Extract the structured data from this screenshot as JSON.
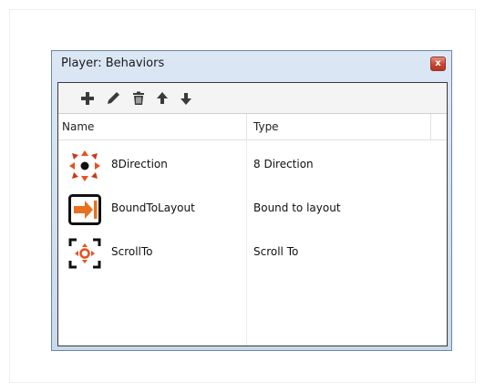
{
  "window": {
    "title": "Player: Behaviors",
    "close_label": "x"
  },
  "toolbar": {
    "buttons": [
      {
        "icon": "add-icon"
      },
      {
        "icon": "pencil-icon"
      },
      {
        "icon": "trash-icon"
      },
      {
        "icon": "arrow-up-icon"
      },
      {
        "icon": "arrow-down-icon"
      }
    ]
  },
  "table": {
    "columns": [
      "Name",
      "Type"
    ],
    "rows": [
      {
        "name": "8Direction",
        "type": "8 Direction",
        "icon": "eight-direction-icon"
      },
      {
        "name": "BoundToLayout",
        "type": "Bound to layout",
        "icon": "bound-to-layout-icon"
      },
      {
        "name": "ScrollTo",
        "type": "Scroll To",
        "icon": "scroll-to-icon"
      }
    ]
  },
  "colors": {
    "accent": "#e8501f",
    "border": "#6d87aa"
  }
}
